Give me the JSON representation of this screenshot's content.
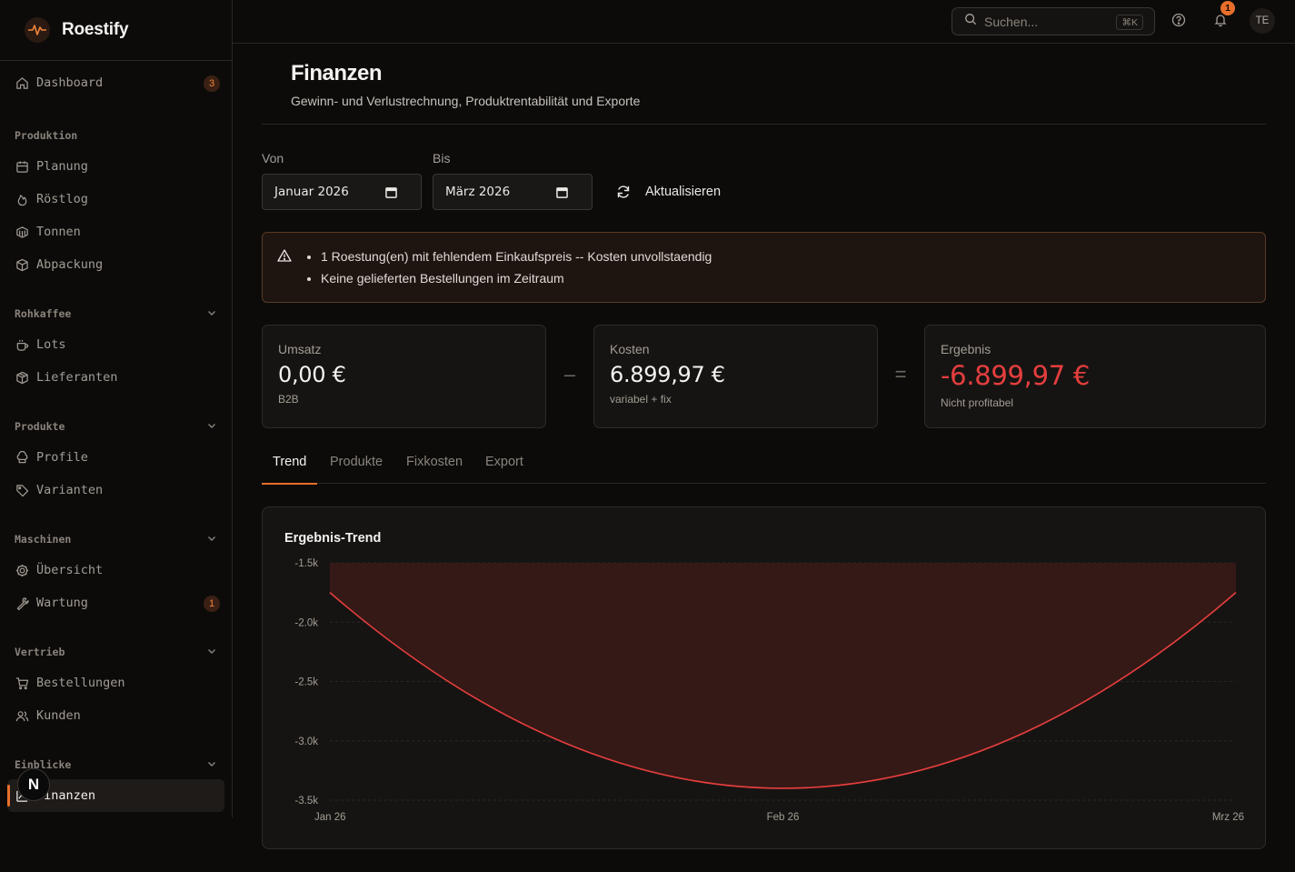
{
  "app": {
    "name": "Roestify"
  },
  "sidebar": {
    "dashboard": {
      "label": "Dashboard",
      "badge": "3"
    },
    "groups": [
      {
        "title": "Produktion",
        "collapsible": false,
        "items": [
          {
            "label": "Planung",
            "icon": "calendar-icon"
          },
          {
            "label": "Röstlog",
            "icon": "flame-icon"
          },
          {
            "label": "Tonnen",
            "icon": "container-icon"
          },
          {
            "label": "Abpackung",
            "icon": "boxes-icon"
          }
        ]
      },
      {
        "title": "Rohkaffee",
        "collapsible": true,
        "items": [
          {
            "label": "Lots",
            "icon": "coffee-icon"
          },
          {
            "label": "Lieferanten",
            "icon": "package-icon"
          }
        ]
      },
      {
        "title": "Produkte",
        "collapsible": true,
        "items": [
          {
            "label": "Profile",
            "icon": "chef-hat-icon"
          },
          {
            "label": "Varianten",
            "icon": "tag-icon"
          }
        ]
      },
      {
        "title": "Maschinen",
        "collapsible": true,
        "items": [
          {
            "label": "Übersicht",
            "icon": "cog-icon"
          },
          {
            "label": "Wartung",
            "icon": "wrench-icon",
            "badge": "1"
          }
        ]
      },
      {
        "title": "Vertrieb",
        "collapsible": true,
        "items": [
          {
            "label": "Bestellungen",
            "icon": "cart-icon"
          },
          {
            "label": "Kunden",
            "icon": "users-icon"
          }
        ]
      },
      {
        "title": "Einblicke",
        "collapsible": true,
        "items": [
          {
            "label": "Finanzen",
            "icon": "chart-icon",
            "active": true
          }
        ]
      }
    ]
  },
  "topbar": {
    "search_placeholder": "Suchen...",
    "shortcut": "⌘K",
    "notifications_count": "1",
    "avatar_initials": "TE"
  },
  "page": {
    "title": "Finanzen",
    "subtitle": "Gewinn- und Verlustrechnung, Produktrentabilität und Exporte"
  },
  "filters": {
    "from_label": "Von",
    "from_value": "Januar 2026",
    "to_label": "Bis",
    "to_value": "März 2026",
    "refresh_label": "Aktualisieren"
  },
  "alert": {
    "messages": [
      "1 Roestung(en) mit fehlendem Einkaufspreis -- Kosten unvollstaendig",
      "Keine gelieferten Bestellungen im Zeitraum"
    ]
  },
  "kpis": {
    "revenue": {
      "label": "Umsatz",
      "value": "0,00 €",
      "sub": "B2B"
    },
    "costs": {
      "label": "Kosten",
      "value": "6.899,97 €",
      "sub": "variabel + fix"
    },
    "result": {
      "label": "Ergebnis",
      "value": "-6.899,97 €",
      "sub": "Nicht profitabel"
    },
    "minus_sign": "–",
    "equals_sign": "="
  },
  "tabs": [
    {
      "label": "Trend",
      "active": true
    },
    {
      "label": "Produkte",
      "active": false
    },
    {
      "label": "Fixkosten",
      "active": false
    },
    {
      "label": "Export",
      "active": false
    }
  ],
  "colors": {
    "accent": "#e76f2b",
    "negative": "#e53e3e",
    "area_fill": "#3a1a18"
  },
  "chart_data": {
    "type": "area",
    "title": "Ergebnis-Trend",
    "categories": [
      "Jan 26",
      "Feb 26",
      "Mrz 26"
    ],
    "series": [
      {
        "values": [
          -1750,
          -3400,
          -1750
        ]
      }
    ],
    "fill_baseline": -1500,
    "ylim": [
      -3500,
      -1500
    ],
    "yticks": [
      -1500,
      -2000,
      -2500,
      -3000,
      -3500
    ],
    "ytick_labels": [
      "-1.5k",
      "-2.0k",
      "-2.5k",
      "-3.0k",
      "-3.5k"
    ],
    "grid": true,
    "smooth": true,
    "legend": "none"
  },
  "dev_badge": "N"
}
